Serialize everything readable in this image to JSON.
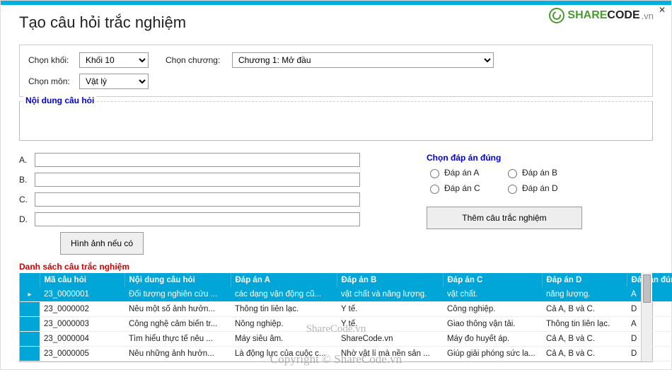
{
  "window": {
    "title": "Tạo câu hỏi trắc nghiệm",
    "logo_share": "SHARE",
    "logo_code": "CODE",
    "logo_suffix": ".vn"
  },
  "filters": {
    "khoi_label": "Chọn khối:",
    "khoi_value": "Khối 10",
    "mon_label": "Chọn môn:",
    "mon_value": "Vật lý",
    "chuong_label": "Chọn chương:",
    "chuong_value": "Chương 1: Mở đầu"
  },
  "question": {
    "legend": "Nội dung câu hỏi",
    "value": ""
  },
  "answers": {
    "a_label": "A.",
    "b_label": "B.",
    "c_label": "C.",
    "d_label": "D.",
    "a_value": "",
    "b_value": "",
    "c_value": "",
    "d_value": "",
    "correct_title": "Chọn đáp án đúng",
    "radio_a": "Đáp án A",
    "radio_b": "Đáp án B",
    "radio_c": "Đáp án C",
    "radio_d": "Đáp án D",
    "btn_image": "Hình ảnh nếu có",
    "btn_add": "Thêm câu trắc nghiệm"
  },
  "list": {
    "title": "Danh sách câu trắc nghiệm",
    "headers": {
      "ma": "Mã câu hỏi",
      "nd": "Nội dung câu hỏi",
      "a": "Đáp án A",
      "b": "Đáp án B",
      "c": "Đáp án C",
      "d": "Đáp án D",
      "dung": "Đáp án đúng"
    },
    "rows": [
      {
        "ma": "23_0000001",
        "nd": "Đối tượng nghiên cứu ...",
        "a": "các dạng vận động cũ...",
        "b": "vật chất và năng lượng.",
        "c": "vật chất.",
        "d": "năng lượng.",
        "dung": "A"
      },
      {
        "ma": "23_0000002",
        "nd": "Nêu một số ảnh hưởn...",
        "a": "Thông tin liên lạc.",
        "b": "Y tế.",
        "c": "Công nghiệp.",
        "d": "Cả A, B và C.",
        "dung": "D"
      },
      {
        "ma": "23_0000003",
        "nd": "Công nghệ cảm biến tr...",
        "a": "Nông nghiệp.",
        "b": "Y tế.",
        "c": "Giao thông vận tải.",
        "d": "Thông tin liên lạc.",
        "dung": "A"
      },
      {
        "ma": "23_0000004",
        "nd": "Tìm hiểu thực tế nêu ...",
        "a": "Máy siêu âm.",
        "b": "ShareCode.vn",
        "c": "Máy đo huyết áp.",
        "d": "Cả A, B và C.",
        "dung": "D"
      },
      {
        "ma": "23_0000005",
        "nd": "Nêu những ảnh hưởn...",
        "a": "Là động lực của cuộc c...",
        "b": "Nhờ vật lí mà nền sản ...",
        "c": "Giúp giải phóng sức la...",
        "d": "Cả A, B và C.",
        "dung": "D"
      }
    ]
  },
  "watermarks": {
    "wm1": "ShareCode.vn",
    "wm2": "Copyright © ShareCode.vn"
  }
}
